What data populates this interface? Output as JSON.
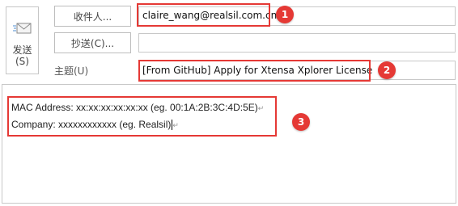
{
  "send": {
    "label": "发送",
    "hint": "(S)",
    "icon": "send-mail-icon"
  },
  "to_button": "收件人...",
  "cc_button": "抄送(C)...",
  "subject_label": "主题(U)",
  "to_value": "claire_wang@realsil.com.cn",
  "cc_value": "",
  "subject_value": "[From GitHub] Apply for Xtensa Xplorer License",
  "body": {
    "line1": "MAC Address: xx:xx:xx:xx:xx:xx (eg. 00:1A:2B:3C:4D:5E)",
    "line2": "Company: xxxxxxxxxxxx (eg. Realsil)",
    "para_mark": "↵"
  },
  "callouts": [
    "1",
    "2",
    "3"
  ],
  "colors": {
    "callout": "#e53935"
  }
}
